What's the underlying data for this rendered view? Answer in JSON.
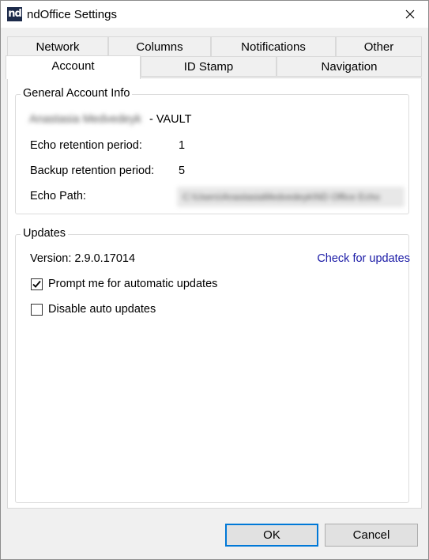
{
  "window": {
    "app_icon_text": "nd",
    "title": "ndOffice Settings"
  },
  "tabs": {
    "back": [
      {
        "label": "Network"
      },
      {
        "label": "Columns"
      },
      {
        "label": "Notifications"
      },
      {
        "label": "Other"
      }
    ],
    "front": [
      {
        "label": "Account",
        "active": true
      },
      {
        "label": "ID Stamp"
      },
      {
        "label": "Navigation"
      }
    ]
  },
  "general": {
    "title": "General Account Info",
    "account_name": "Anastasia Medvedeyk",
    "account_suffix": "- VAULT",
    "echo_retention_label": "Echo retention period:",
    "echo_retention_value": "1",
    "backup_retention_label": "Backup retention period:",
    "backup_retention_value": "5",
    "echo_path_label": "Echo Path:",
    "echo_path_value": "C:\\Users\\AnastasiaMedvedeyk\\ND Office Echo"
  },
  "updates": {
    "title": "Updates",
    "version_label": "Version: 2.9.0.17014",
    "check_link": "Check for updates",
    "prompt_label": "Prompt me for automatic updates",
    "prompt_checked": true,
    "disable_label": "Disable auto updates",
    "disable_checked": false
  },
  "buttons": {
    "ok": "OK",
    "cancel": "Cancel"
  }
}
